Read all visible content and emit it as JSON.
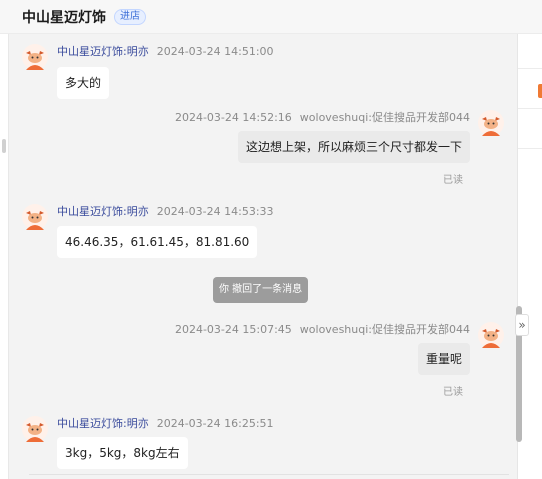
{
  "header": {
    "title": "中山星迈灯饰",
    "badge": "进店"
  },
  "messages": [
    {
      "side": "left",
      "name": "中山星迈灯饰:明亦",
      "time": "2024-03-24 14:51:00",
      "text": "多大的"
    },
    {
      "side": "right",
      "time": "2024-03-24 14:52:16",
      "sender": "woloveshuqi:促佳搜品开发部044",
      "text": "这边想上架，所以麻烦三个尺寸都发一下",
      "status": "已读"
    },
    {
      "side": "left",
      "name": "中山星迈灯饰:明亦",
      "time": "2024-03-24 14:53:33",
      "text": "46.46.35，61.61.45，81.81.60"
    },
    {
      "side": "right",
      "time": "2024-03-24 15:07:45",
      "sender": "woloveshuqi:促佳搜品开发部044",
      "text": "重量呢",
      "status": "已读"
    },
    {
      "side": "left",
      "name": "中山星迈灯饰:明亦",
      "time": "2024-03-24 16:25:51",
      "text": "3kg，5kg，8kg左右"
    }
  ],
  "recall_notice": "你 撤回了一条消息",
  "icons": {
    "avatar": "cartoon-avatar-icon",
    "expand": "double-chevron-right-icon"
  },
  "colors": {
    "accent": "#f07a34",
    "name_link": "#3a4b9c",
    "badge": "#3e6fd8"
  }
}
